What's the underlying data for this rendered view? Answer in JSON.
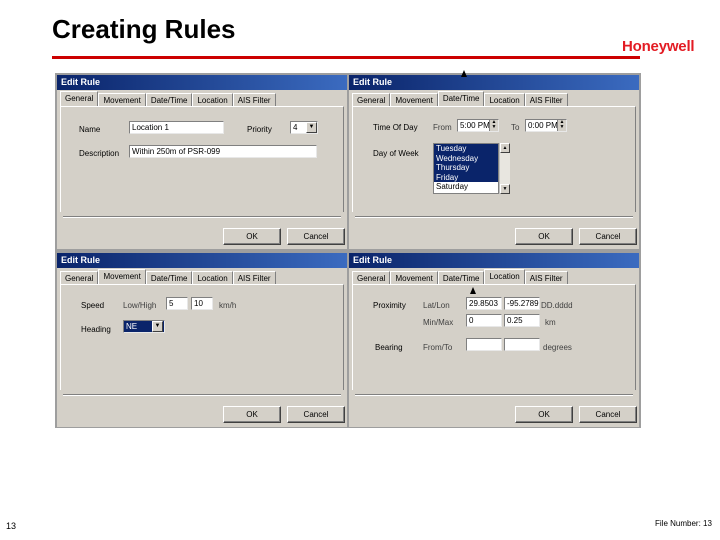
{
  "slide": {
    "title": "Creating Rules",
    "logo": "Honeywell",
    "page_number": "13",
    "file_number": "File Number: 13"
  },
  "colors": {
    "accent_rule": "#cc0000",
    "brand": "#e31b23",
    "titlebar": "#0a246a",
    "dialog_bg": "#d4d0c8"
  },
  "dialog": {
    "title": "Edit Rule",
    "tabs": [
      "General",
      "Movement",
      "Date/Time",
      "Location",
      "AIS Filter"
    ],
    "ok": "OK",
    "cancel": "Cancel"
  },
  "general": {
    "name_label": "Name",
    "name_value": "Location 1",
    "priority_label": "Priority",
    "priority_value": "4",
    "description_label": "Description",
    "description_value": "Within 250m of PSR-099"
  },
  "datetime": {
    "time_of_day_label": "Time Of Day",
    "from_label": "From",
    "from_value": "5:00 PM",
    "to_label": "To",
    "to_value": "0:00 PM",
    "day_of_week_label": "Day of Week",
    "days": [
      {
        "label": "Tuesday",
        "selected": true
      },
      {
        "label": "Wednesday",
        "selected": true
      },
      {
        "label": "Thursday",
        "selected": true
      },
      {
        "label": "Friday",
        "selected": true
      },
      {
        "label": "Saturday",
        "selected": false
      }
    ]
  },
  "movement": {
    "speed_label": "Speed",
    "low_high_label": "Low/High",
    "low_value": "5",
    "high_value": "10",
    "speed_unit": "km/h",
    "heading_label": "Heading",
    "heading_value": "NE"
  },
  "location": {
    "proximity_label": "Proximity",
    "lat_lon_label": "Lat/Lon",
    "lat_value": "29.8503",
    "lon_value": "-95.2789",
    "dd_format": "DD.dddd",
    "min_max_label": "Min/Max",
    "min_value": "0",
    "max_value": "0.25",
    "distance_unit": "km",
    "bearing_label": "Bearing",
    "from_to_label": "From/To",
    "bearing_from": "",
    "bearing_to": "",
    "bearing_unit": "degrees"
  }
}
